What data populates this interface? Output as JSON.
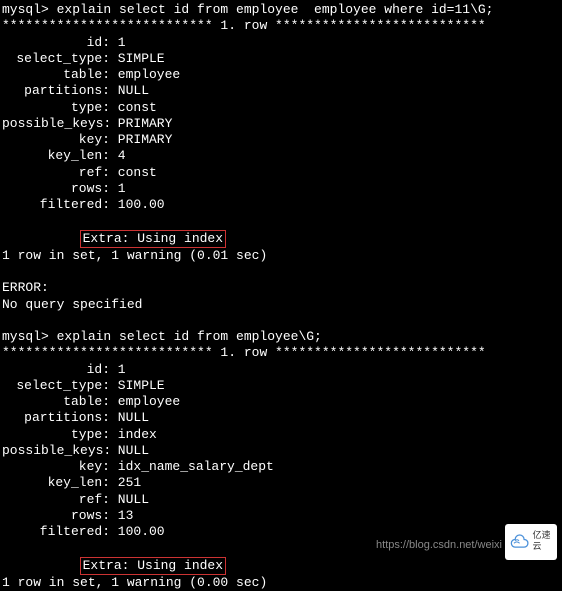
{
  "query1": {
    "prompt": "mysql> explain select id from employee  employee where id=11\\G;",
    "separator": "*************************** 1. row ***************************",
    "fields": [
      {
        "label": "id",
        "value": "1"
      },
      {
        "label": "select_type",
        "value": "SIMPLE"
      },
      {
        "label": "table",
        "value": "employee"
      },
      {
        "label": "partitions",
        "value": "NULL"
      },
      {
        "label": "type",
        "value": "const"
      },
      {
        "label": "possible_keys",
        "value": "PRIMARY"
      },
      {
        "label": "key",
        "value": "PRIMARY"
      },
      {
        "label": "key_len",
        "value": "4"
      },
      {
        "label": "ref",
        "value": "const"
      },
      {
        "label": "rows",
        "value": "1"
      },
      {
        "label": "filtered",
        "value": "100.00"
      }
    ],
    "extra_label": "Extra: ",
    "extra_value": "Using index",
    "result": "1 row in set, 1 warning (0.01 sec)"
  },
  "error": {
    "label": "ERROR:",
    "message": "No query specified"
  },
  "query2": {
    "prompt": "mysql> explain select id from employee\\G;",
    "separator": "*************************** 1. row ***************************",
    "fields": [
      {
        "label": "id",
        "value": "1"
      },
      {
        "label": "select_type",
        "value": "SIMPLE"
      },
      {
        "label": "table",
        "value": "employee"
      },
      {
        "label": "partitions",
        "value": "NULL"
      },
      {
        "label": "type",
        "value": "index"
      },
      {
        "label": "possible_keys",
        "value": "NULL"
      },
      {
        "label": "key",
        "value": "idx_name_salary_dept"
      },
      {
        "label": "key_len",
        "value": "251"
      },
      {
        "label": "ref",
        "value": "NULL"
      },
      {
        "label": "rows",
        "value": "13"
      },
      {
        "label": "filtered",
        "value": "100.00"
      }
    ],
    "extra_label": "Extra: ",
    "extra_value": "Using index",
    "result": "1 row in set, 1 warning (0.00 sec)"
  },
  "watermark": "https://blog.csdn.net/weixi",
  "logo_text": "亿速云"
}
